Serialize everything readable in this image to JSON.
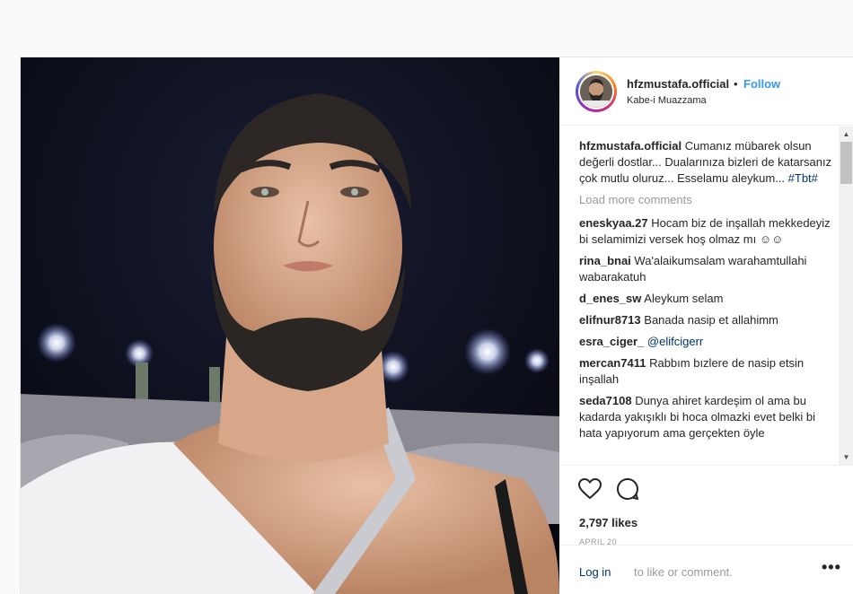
{
  "post": {
    "username": "hfzmustafa.official",
    "separator": "•",
    "follow_label": "Follow",
    "location": "Kabe-i Muazzama",
    "caption": {
      "username": "hfzmustafa.official",
      "text": "Cumanız mübarek olsun değerli dostlar... Dualarınıza bizleri de katarsanız çok mutlu oluruz... Esselamu aleykum...",
      "hashtag": "#Tbt#"
    },
    "load_more": "Load more comments",
    "comments": [
      {
        "user": "eneskyaa.27",
        "text": "Hocam biz de inşallah mekkedeyiz bi selamimizi versek hoş olmaz mı ☺☺"
      },
      {
        "user": "rina_bnai",
        "text": "Wa'alaikumsalam warahamtullahi wabarakatuh"
      },
      {
        "user": "d_enes_sw",
        "text": "Aleykum selam"
      },
      {
        "user": "elifnur8713",
        "text": "Banada nasip et allahimm"
      },
      {
        "user": "esra_ciger_",
        "text": "@elifcigerr"
      },
      {
        "user": "mercan7411",
        "text": "Rabbım bızlere de nasip etsin inşallah"
      },
      {
        "user": "seda7108",
        "text": "Dunya ahiret kardeşim ol ama bu kadarda yakışıklı bi hoca olmazki evet belki bi hata yapıyorum ama gerçekten öyle"
      }
    ],
    "likes": "2,797 likes",
    "date": "APRIL 20",
    "footer": {
      "login_label": "Log in",
      "login_rest": " to like or comment.",
      "more_label": "•••"
    },
    "icons": {
      "like": "heart-outline-icon",
      "comment": "speech-bubble-icon",
      "more": "ellipsis-icon"
    }
  }
}
